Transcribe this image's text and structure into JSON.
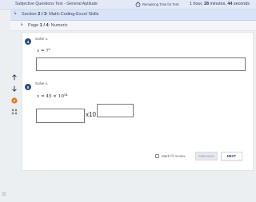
{
  "header": {
    "title": "Subjective Questions Test - General Aptitude",
    "timer_label": "Remaining Time for Test:",
    "timer_parts": {
      "hours": "1",
      "hours_unit": "hour,",
      "minutes": "28",
      "minutes_unit": "minutes,",
      "seconds": "44",
      "seconds_unit": "seconds"
    }
  },
  "section_bar": {
    "prefix": "Section",
    "current": "2",
    "sep": "/",
    "total": "3",
    "name": ": Math-Coding-Excel Skills"
  },
  "page_bar": {
    "prefix": "Page",
    "current": "1",
    "sep": "/",
    "total": "4",
    "type": ": Numeric"
  },
  "questions": [
    {
      "number": "4",
      "prompt": "Solve x.",
      "equation": {
        "lhs": "x",
        "eq": "=",
        "base": "7",
        "exp": "2"
      },
      "answer_value": ""
    },
    {
      "number": "5",
      "prompt": "Solve x.",
      "equation": {
        "lhs": "x",
        "eq": "=",
        "mult": "45 × 10",
        "exp": "14"
      },
      "mantissa_value": "",
      "times_ten": "x10",
      "exponent_value": ""
    }
  ],
  "footer": {
    "mark_review_label": "Mark f/r review",
    "previous_label": "PREVIOUS",
    "next_label": "NEXT"
  },
  "colors": {
    "header_bg": "#e3e9f6",
    "section_bg": "#d9e2f6",
    "badge_blue": "#2d4a84",
    "help_orange": "#e07a1f"
  },
  "icons": {
    "timer": "stopwatch-icon",
    "up": "arrow-up-icon",
    "down": "arrow-down-icon",
    "help": "help-circle-icon",
    "grid": "grid-icon",
    "menu": "hamburger-icon"
  }
}
